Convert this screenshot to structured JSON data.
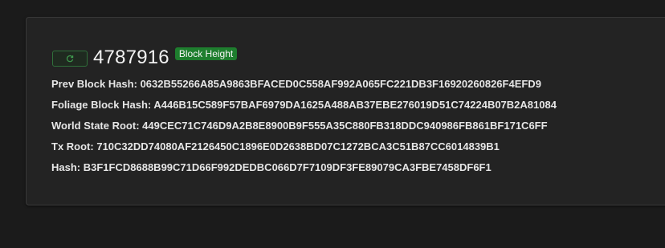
{
  "block": {
    "height": "4787916",
    "badge_label": "Block Height",
    "refresh_icon": "refresh-icon",
    "fields": [
      {
        "label": "Prev Block Hash:",
        "value": "0632B55266A85A9863BFACED0C558AF992A065FC221DB3F16920260826F4EFD9"
      },
      {
        "label": "Foliage Block Hash:",
        "value": "A446B15C589F57BAF6979DA1625A488AB37EBE276019D51C74224B07B2A81084"
      },
      {
        "label": "World State Root:",
        "value": "449CEC71C746D9A2B8E8900B9F555A35C880FB318DDC940986FB861BF171C6FF"
      },
      {
        "label": "Tx Root:",
        "value": "710C32DD74080AF2126450C1896E0D2638BD07C1272BCA3C51B87CC6014839B1"
      },
      {
        "label": "Hash:",
        "value": "B3F1FCD8688B99C71D66F992DEDBC066D7F7109DF3FE89079CA3FBE7458DF6F1"
      }
    ]
  },
  "colors": {
    "background": "#1b1b1b",
    "card": "#232323",
    "badge": "#1e7e2e",
    "button_border": "#2f6f3a"
  }
}
